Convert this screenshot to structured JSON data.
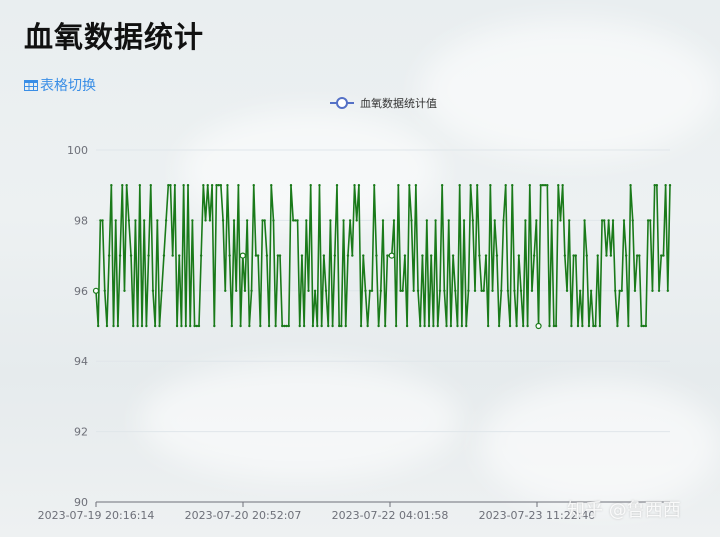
{
  "page": {
    "title": "血氧数据统计",
    "table_toggle_label": "表格切换",
    "watermark": "知乎 @鲁西西"
  },
  "colors": {
    "series_line": "#1a7a1a",
    "legend_marker": "#5470c6",
    "link": "#3a8ee6",
    "axis": "#6e7079",
    "grid": "#e0e6ea"
  },
  "icons": {
    "table_toggle": "table-icon",
    "legend": "circle-line-marker"
  },
  "chart_data": {
    "type": "line",
    "title": "",
    "xlabel": "",
    "ylabel": "",
    "ylim": [
      90,
      100
    ],
    "y_ticks": [
      90,
      92,
      94,
      96,
      98,
      100
    ],
    "x_tick_labels": [
      "2023-07-19 20:16:14",
      "2023-07-20 20:52:07",
      "2023-07-22 04:01:58",
      "2023-07-23 11:22:40"
    ],
    "legend_position": "top-center",
    "grid": true,
    "series": [
      {
        "name": "血氧数据统计值",
        "values": [
          96,
          95,
          98,
          98,
          96,
          95,
          97,
          99,
          95,
          98,
          95,
          97,
          99,
          96,
          99,
          98,
          97,
          95,
          98,
          95,
          99,
          95,
          98,
          95,
          97,
          99,
          96,
          95,
          98,
          95,
          96,
          97,
          98,
          99,
          99,
          97,
          99,
          95,
          97,
          95,
          99,
          95,
          99,
          95,
          98,
          95,
          95,
          95,
          97,
          99,
          98,
          99,
          98,
          99,
          95,
          99,
          99,
          99,
          98,
          96,
          99,
          97,
          95,
          98,
          96,
          99,
          95,
          97,
          96,
          98,
          95,
          96,
          99,
          97,
          97,
          95,
          98,
          98,
          97,
          95,
          99,
          98,
          95,
          97,
          97,
          95,
          95,
          95,
          95,
          99,
          98,
          98,
          98,
          95,
          97,
          95,
          98,
          96,
          99,
          95,
          96,
          95,
          99,
          95,
          97,
          96,
          95,
          98,
          95,
          97,
          99,
          95,
          95,
          98,
          95,
          97,
          98,
          97,
          99,
          98,
          99,
          95,
          97,
          96,
          95,
          96,
          96,
          99,
          97,
          95,
          96,
          98,
          95,
          97,
          97,
          97,
          98,
          95,
          99,
          96,
          96,
          97,
          95,
          99,
          98,
          96,
          99,
          96,
          95,
          97,
          95,
          98,
          95,
          97,
          95,
          98,
          95,
          96,
          99,
          96,
          95,
          98,
          95,
          97,
          96,
          95,
          99,
          95,
          98,
          95,
          96,
          99,
          98,
          96,
          99,
          97,
          96,
          96,
          97,
          95,
          99,
          96,
          98,
          97,
          95,
          96,
          98,
          99,
          96,
          95,
          99,
          96,
          95,
          97,
          96,
          95,
          98,
          95,
          99,
          96,
          97,
          98,
          95,
          99,
          99,
          99,
          99,
          95,
          98,
          95,
          95,
          99,
          98,
          99,
          97,
          96,
          98,
          95,
          97,
          97,
          95,
          96,
          95,
          98,
          97,
          95,
          96,
          95,
          95,
          97,
          95,
          98,
          98,
          97,
          98,
          97,
          98,
          96,
          95,
          96,
          96,
          98,
          97,
          95,
          99,
          98,
          96,
          97,
          97,
          95,
          95,
          95,
          98,
          98,
          96,
          99,
          99,
          96,
          97,
          97,
          99,
          96,
          99
        ]
      }
    ]
  }
}
